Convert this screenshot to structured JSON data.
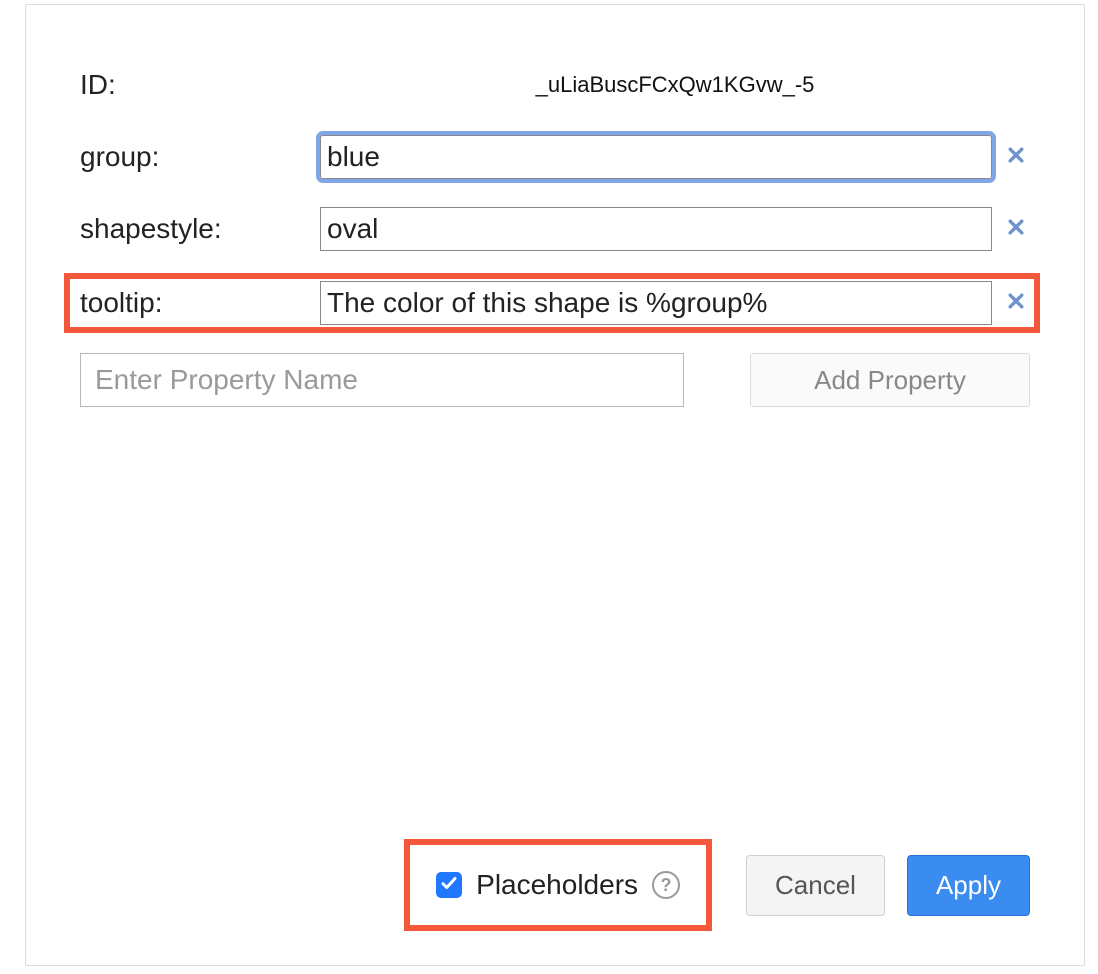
{
  "labels": {
    "id": "ID:",
    "group": "group:",
    "shapestyle": "shapestyle:",
    "tooltip": "tooltip:"
  },
  "values": {
    "id": "_uLiaBuscFCxQw1KGvw_-5",
    "group": "blue",
    "shapestyle": "oval",
    "tooltip": "The color of this shape is %group%"
  },
  "newProperty": {
    "placeholder": "Enter Property Name",
    "addButton": "Add Property"
  },
  "footer": {
    "placeholdersLabel": "Placeholders",
    "placeholdersChecked": true,
    "cancel": "Cancel",
    "apply": "Apply"
  }
}
